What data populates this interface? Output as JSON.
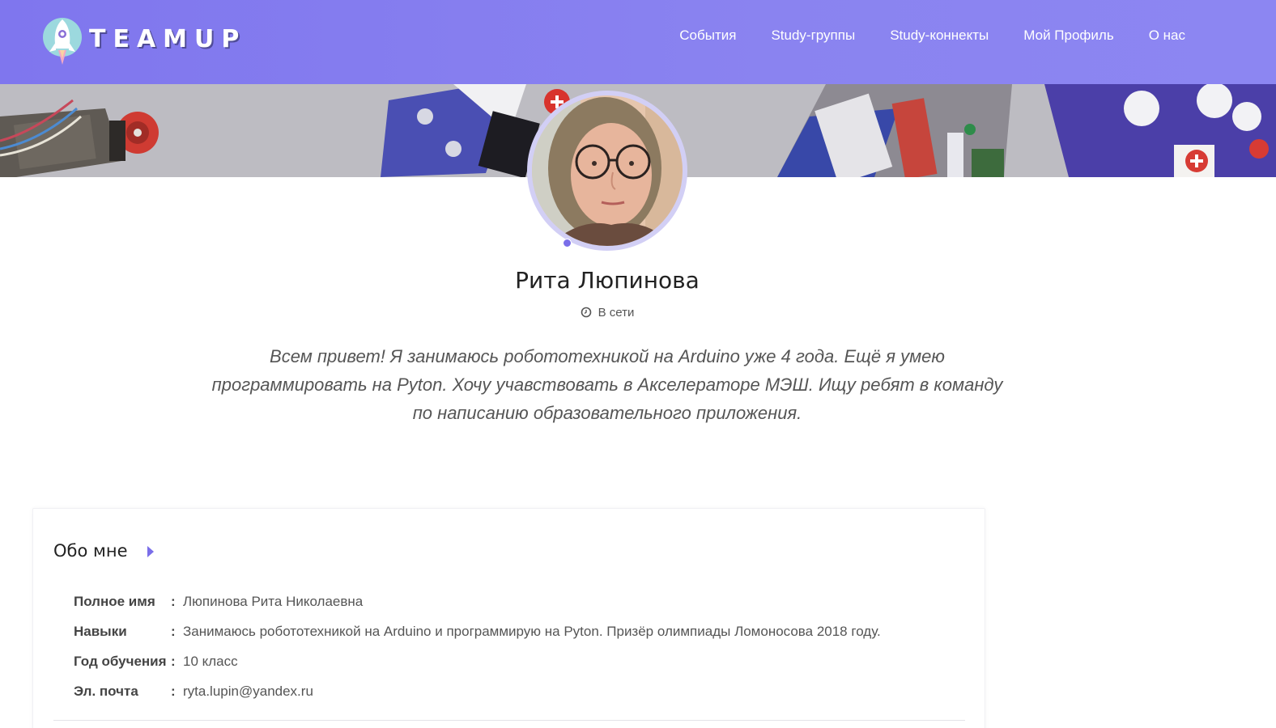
{
  "brand": {
    "logo_text": "TEAMUP",
    "accent": "#7f76ee",
    "status_dot": "#7a6ee9"
  },
  "nav": {
    "items": [
      {
        "label": "События"
      },
      {
        "label": "Study-группы"
      },
      {
        "label": "Study-коннекты"
      },
      {
        "label": "Мой Профиль"
      },
      {
        "label": "О нас"
      }
    ]
  },
  "profile": {
    "name": "Рита Люпинова",
    "status": "В сети",
    "status_icon": "clock-icon",
    "bio": "Всем привет! Я занимаюсь робототехникой на Arduino уже 4 года. Ещё я умею программировать на Pyton. Хочу учавствовать в Акселераторе МЭШ. Ищу ребят в команду по написанию образовательного приложения."
  },
  "about": {
    "title": "Обо мне",
    "rows": [
      {
        "label": "Полное имя",
        "value": "Люпинова Рита Николаевна"
      },
      {
        "label": "Навыки",
        "value": "Занимаюсь робототехникой на Arduino и программирую на Pyton. Призёр олимпиады Ломоносова 2018 году."
      },
      {
        "label": "Год обучения",
        "value": "10 класс"
      },
      {
        "label": "Эл. почта",
        "value": "ryta.lupin@yandex.ru"
      }
    ]
  }
}
